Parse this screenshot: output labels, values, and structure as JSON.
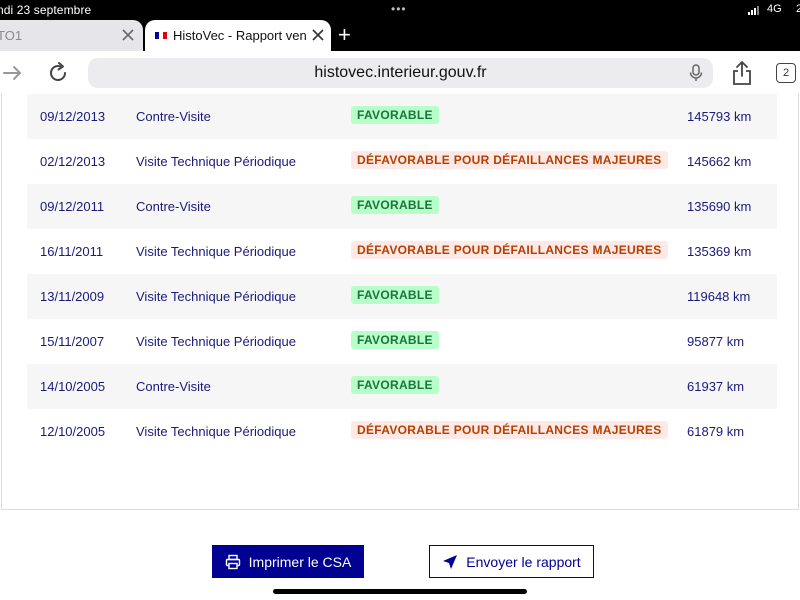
{
  "status_bar": {
    "date": "ndi 23 septembre",
    "dots": "•••",
    "network": "4G",
    "battery_partial": "2"
  },
  "tabs": [
    {
      "title": "TO1",
      "active": false
    },
    {
      "title": "HistoVec - Rapport vendeur",
      "active": true
    }
  ],
  "new_tab_label": "+",
  "toolbar": {
    "url": "histovec.interieur.gouv.fr",
    "tabs_count": "2"
  },
  "inspections": [
    {
      "date": "09/12/2013",
      "type": "Contre-Visite",
      "result": "FAVORABLE",
      "result_kind": "ok",
      "km": "145793 km"
    },
    {
      "date": "02/12/2013",
      "type": "Visite Technique Périodique",
      "result": "DÉFAVORABLE POUR DÉFAILLANCES MAJEURES",
      "result_kind": "ko",
      "km": "145662 km"
    },
    {
      "date": "09/12/2011",
      "type": "Contre-Visite",
      "result": "FAVORABLE",
      "result_kind": "ok",
      "km": "135690 km"
    },
    {
      "date": "16/11/2011",
      "type": "Visite Technique Périodique",
      "result": "DÉFAVORABLE POUR DÉFAILLANCES MAJEURES",
      "result_kind": "ko",
      "km": "135369 km"
    },
    {
      "date": "13/11/2009",
      "type": "Visite Technique Périodique",
      "result": "FAVORABLE",
      "result_kind": "ok",
      "km": "119648 km"
    },
    {
      "date": "15/11/2007",
      "type": "Visite Technique Périodique",
      "result": "FAVORABLE",
      "result_kind": "ok",
      "km": "95877 km"
    },
    {
      "date": "14/10/2005",
      "type": "Contre-Visite",
      "result": "FAVORABLE",
      "result_kind": "ok",
      "km": "61937 km"
    },
    {
      "date": "12/10/2005",
      "type": "Visite Technique Périodique",
      "result": "DÉFAVORABLE POUR DÉFAILLANCES MAJEURES",
      "result_kind": "ko",
      "km": "61879 km"
    }
  ],
  "actions": {
    "print_label": "Imprimer le CSA",
    "send_label": "Envoyer le rapport"
  },
  "colors": {
    "primary": "#000091",
    "favorable_bg": "#b8fec9",
    "favorable_text": "#18753c",
    "defavorable_bg": "#ffe9e6",
    "defavorable_text": "#b34000",
    "row_text": "#1a1a7a"
  },
  "icons": {
    "back": "arrow-right-icon",
    "reload": "reload-icon",
    "mic": "microphone-icon",
    "share": "share-icon",
    "print": "printer-icon",
    "send": "paper-plane-icon"
  }
}
